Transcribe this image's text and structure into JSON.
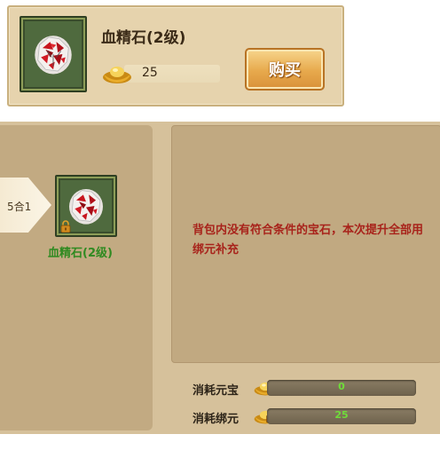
{
  "shop": {
    "item_name": "血精石(2级)",
    "price": "25",
    "buy_label": "购买"
  },
  "compose": {
    "ratio_label": "5合1",
    "target_name": "血精石(2级)",
    "message": "背包内没有符合条件的宝石，本次提升全部用绑元补充",
    "costs": [
      {
        "label": "消耗元宝",
        "value": "0"
      },
      {
        "label": "消耗绑元",
        "value": "25"
      }
    ]
  },
  "colors": {
    "item_name_green": "#2f8a21",
    "message_red": "#a8231b",
    "bar_value_green": "#6fdc3a"
  },
  "icons": {
    "gem": "blood-gem-icon",
    "ingot": "gold-ingot-icon",
    "lock": "lock-icon"
  }
}
